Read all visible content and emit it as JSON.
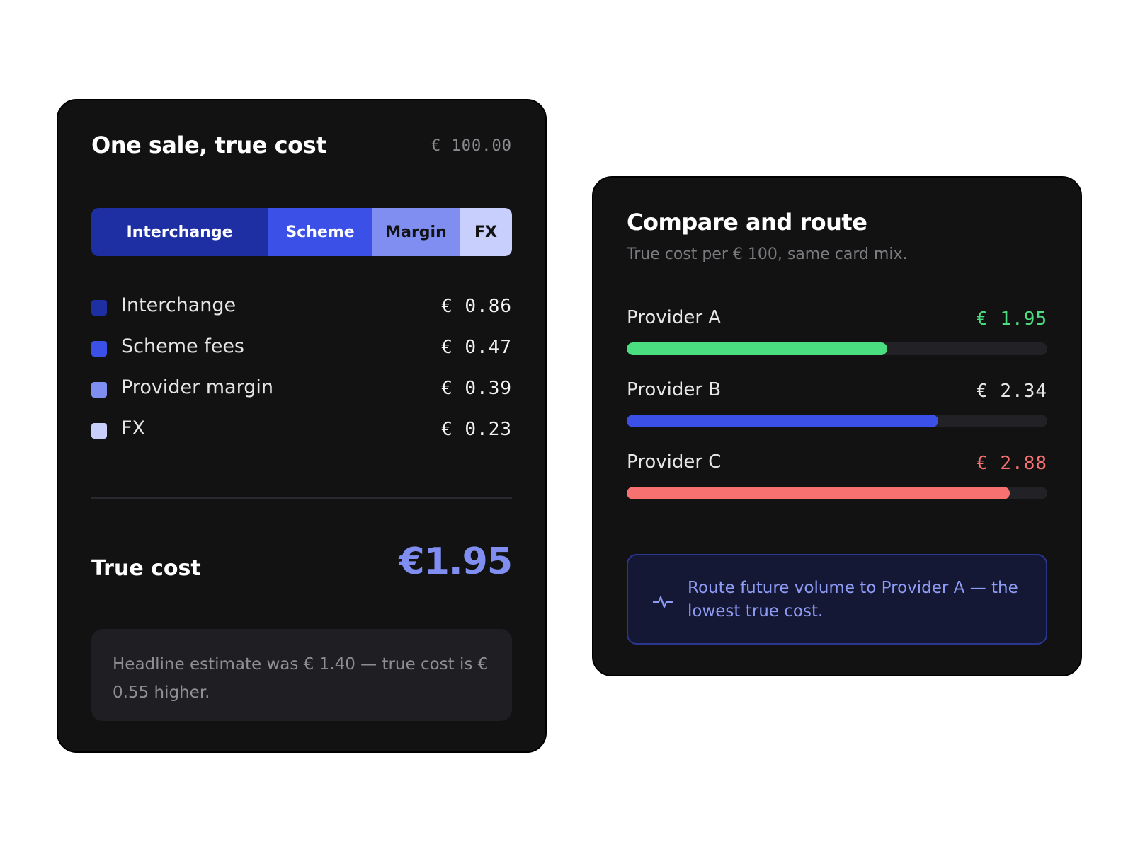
{
  "left_card": {
    "title": "One sale, true cost",
    "sale_amount": "€ 100.00",
    "segments": [
      {
        "label": "Interchange",
        "color": "#1e2fa3"
      },
      {
        "label": "Scheme",
        "color": "#3b50e6"
      },
      {
        "label": "Margin",
        "color": "#7f8ef0"
      },
      {
        "label": "FX",
        "color": "#c9cffc"
      }
    ],
    "breakdown": [
      {
        "label": "Interchange",
        "value": "€ 0.86",
        "color": "#1e2fa3"
      },
      {
        "label": "Scheme fees",
        "value": "€ 0.47",
        "color": "#3b50e6"
      },
      {
        "label": "Provider margin",
        "value": "€ 0.39",
        "color": "#7f8ef0"
      },
      {
        "label": "FX",
        "value": "€ 0.23",
        "color": "#c9cffc"
      }
    ],
    "true_cost_label": "True cost",
    "true_cost_value": "€1.95",
    "note": "Headline estimate was € 1.40 — true cost is € 0.55 higher."
  },
  "right_card": {
    "title": "Compare and route",
    "subtitle": "True cost per € 100, same card mix.",
    "providers": [
      {
        "label": "Provider A",
        "value": "€ 1.95",
        "fill_fraction": 0.62,
        "color": "#4ade80"
      },
      {
        "label": "Provider B",
        "value": "€ 2.34",
        "fill_fraction": 0.74,
        "color": "#3b50e6"
      },
      {
        "label": "Provider C",
        "value": "€ 2.88",
        "fill_fraction": 0.91,
        "color": "#f87171"
      }
    ],
    "callout_icon": "activity-pulse-icon",
    "callout_text": "Route future volume to Provider A — the lowest true cost."
  }
}
